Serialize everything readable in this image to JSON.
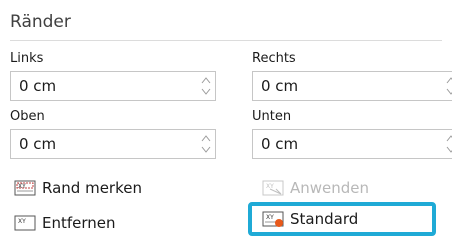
{
  "section": {
    "title": "Ränder"
  },
  "fields": {
    "left": {
      "label": "Links",
      "value": "0 cm"
    },
    "right": {
      "label": "Rechts",
      "value": "0 cm"
    },
    "top": {
      "label": "Oben",
      "value": "0 cm"
    },
    "bottom": {
      "label": "Unten",
      "value": "0 cm"
    }
  },
  "buttons": {
    "mark": {
      "label": "Rand merken",
      "icon": "xy-margin-icon"
    },
    "apply": {
      "label": "Anwenden",
      "icon": "xy-apply-icon",
      "disabled": true
    },
    "remove": {
      "label": "Entfernen",
      "icon": "xy-remove-icon"
    },
    "standard": {
      "label": "Standard",
      "icon": "xy-standard-icon"
    }
  },
  "colors": {
    "highlight": "#1faad6",
    "badge": "#e8591a"
  }
}
